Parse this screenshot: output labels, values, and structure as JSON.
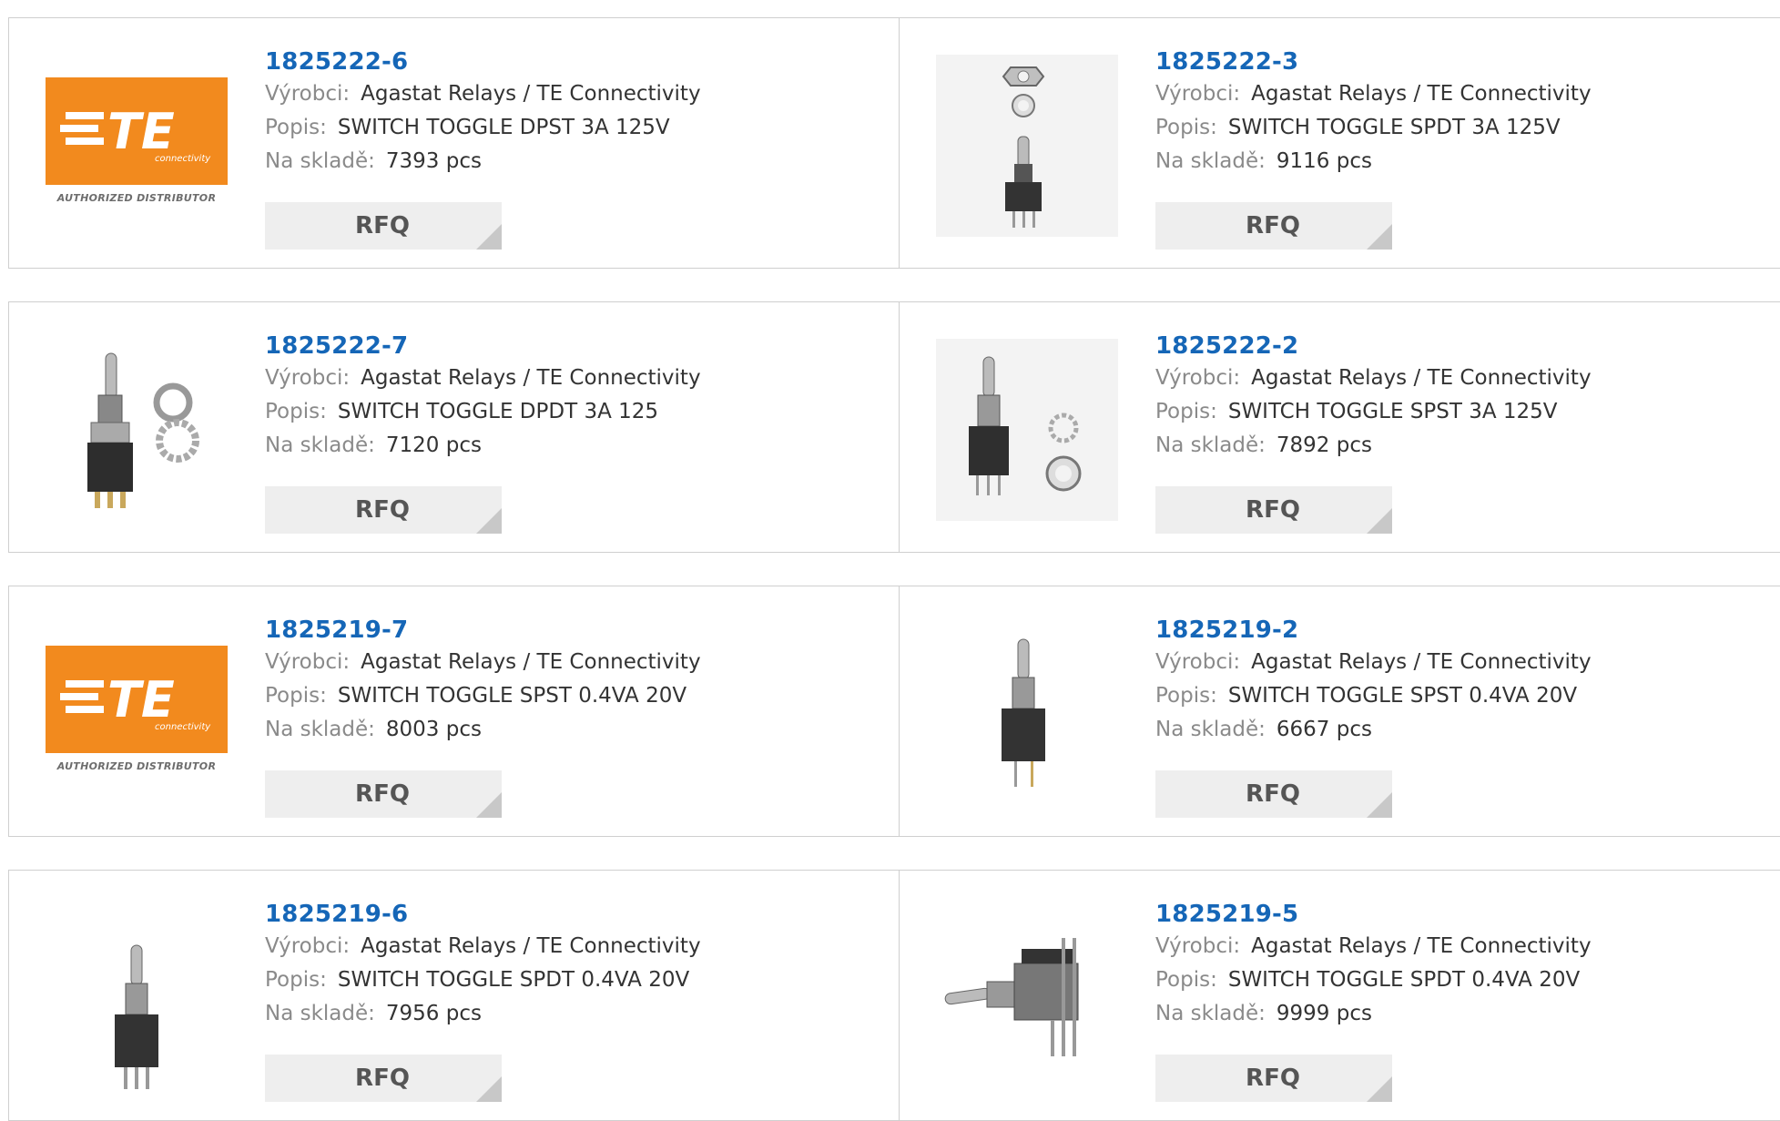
{
  "labels": {
    "manufacturer": "Výrobci:",
    "description": "Popis:",
    "stock": "Na skladě:",
    "rfq": "RFQ"
  },
  "te_logo": {
    "word": "TE",
    "sub": "connectivity",
    "tagline": "AUTHORIZED DISTRIBUTOR"
  },
  "products": [
    {
      "part": "1825222-6",
      "manufacturer": "Agastat Relays / TE Connectivity",
      "description": "SWITCH TOGGLE DPST 3A 125V",
      "stock": "7393 pcs",
      "image": "te-logo"
    },
    {
      "part": "1825222-3",
      "manufacturer": "Agastat Relays / TE Connectivity",
      "description": "SWITCH TOGGLE SPDT 3A 125V",
      "stock": "9116 pcs",
      "image": "toggle-switch-with-nut-washer"
    },
    {
      "part": "1825222-7",
      "manufacturer": "Agastat Relays / TE Connectivity",
      "description": "SWITCH TOGGLE DPDT 3A 125",
      "stock": "7120 pcs",
      "image": "toggle-switch-with-washers"
    },
    {
      "part": "1825222-2",
      "manufacturer": "Agastat Relays / TE Connectivity",
      "description": "SWITCH TOGGLE SPST 3A 125V",
      "stock": "7892 pcs",
      "image": "toggle-switch-with-washers"
    },
    {
      "part": "1825219-7",
      "manufacturer": "Agastat Relays / TE Connectivity",
      "description": "SWITCH TOGGLE SPST 0.4VA 20V",
      "stock": "8003 pcs",
      "image": "te-logo"
    },
    {
      "part": "1825219-2",
      "manufacturer": "Agastat Relays / TE Connectivity",
      "description": "SWITCH TOGGLE SPST 0.4VA 20V",
      "stock": "6667 pcs",
      "image": "toggle-switch"
    },
    {
      "part": "1825219-6",
      "manufacturer": "Agastat Relays / TE Connectivity",
      "description": "SWITCH TOGGLE SPDT 0.4VA 20V",
      "stock": "7956 pcs",
      "image": "toggle-switch"
    },
    {
      "part": "1825219-5",
      "manufacturer": "Agastat Relays / TE Connectivity",
      "description": "SWITCH TOGGLE SPDT 0.4VA 20V",
      "stock": "9999 pcs",
      "image": "right-angle-toggle-switch"
    }
  ]
}
